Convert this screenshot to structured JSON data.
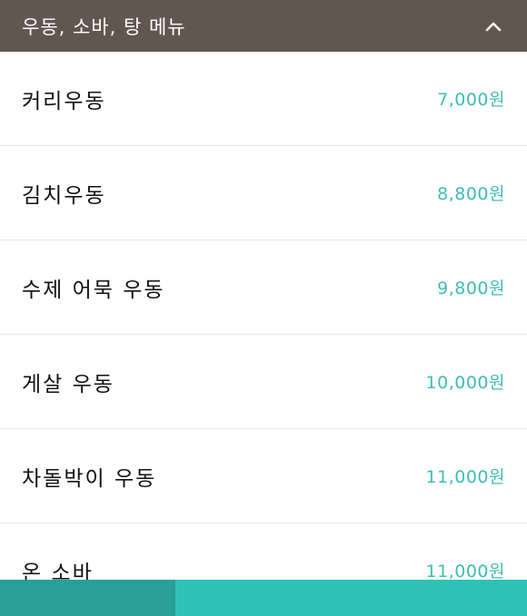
{
  "header": {
    "title": "우동, 소바, 탕 메뉴",
    "collapse_icon": "chevron-up-icon"
  },
  "menu": {
    "items": [
      {
        "name": "커리우동",
        "price": "7,000원"
      },
      {
        "name": "김치우동",
        "price": "8,800원"
      },
      {
        "name": "수제 어묵 우동",
        "price": "9,800원"
      },
      {
        "name": "게살 우동",
        "price": "10,000원"
      },
      {
        "name": "차돌박이 우동",
        "price": "11,000원"
      },
      {
        "name": "온 소바",
        "price": "11,000원"
      }
    ]
  },
  "colors": {
    "header_bg": "#625750",
    "price": "#3fbdb4",
    "bottom_left": "#2a9f97",
    "bottom_right": "#2ec2b7"
  }
}
